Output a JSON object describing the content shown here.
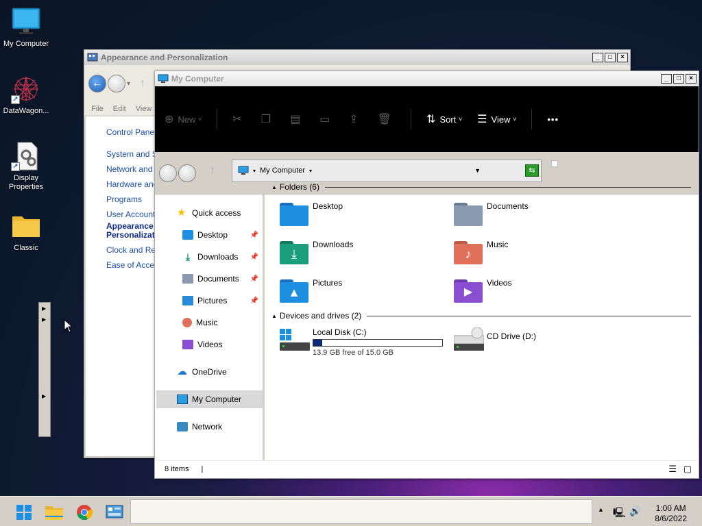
{
  "desktop": {
    "icons": [
      {
        "label": "My Computer"
      },
      {
        "label": "DataWagon..."
      },
      {
        "label": "Display Properties"
      },
      {
        "label": "Classic"
      }
    ]
  },
  "cp_window": {
    "title": "Appearance and Personalization",
    "menu": [
      "File",
      "Edit",
      "View"
    ],
    "links": [
      "Control Panel H",
      "System and Se",
      "Network and Ir",
      "Hardware and",
      "Programs",
      "User Accounts",
      "Appearance Personalizat",
      "Clock and Regi",
      "Ease of Access"
    ],
    "current_link_line1": "Appearance",
    "current_link_line2": "Personalizat"
  },
  "mc_window": {
    "title": "My Computer",
    "commands": {
      "new": "New",
      "sort": "Sort",
      "view": "View",
      "more": "•••"
    },
    "address": "My Computer",
    "nav": {
      "quick_access": "Quick access",
      "desktop": "Desktop",
      "downloads": "Downloads",
      "documents": "Documents",
      "pictures": "Pictures",
      "music": "Music",
      "videos": "Videos",
      "onedrive": "OneDrive",
      "my_computer": "My Computer",
      "network": "Network"
    },
    "folders_header": "Folders (6)",
    "folders": [
      "Desktop",
      "Documents",
      "Downloads",
      "Music",
      "Pictures",
      "Videos"
    ],
    "drives_header": "Devices and drives (2)",
    "drive_c": {
      "name": "Local Disk (C:)",
      "free": "13.9 GB free of 15.0 GB",
      "used_fraction": 0.07
    },
    "drive_d": {
      "name": "CD Drive (D:)"
    },
    "status": "8 items"
  },
  "taskbar": {
    "time": "1:00 AM",
    "date": "8/6/2022"
  },
  "colors": {
    "accent": "#1c5db8",
    "folder_blue": "#1e8fe0",
    "folder_teal": "#1a9e7e",
    "folder_music": "#e0705a",
    "folder_video": "#8a4fd0",
    "drive_bar": "#0a2a7a"
  }
}
